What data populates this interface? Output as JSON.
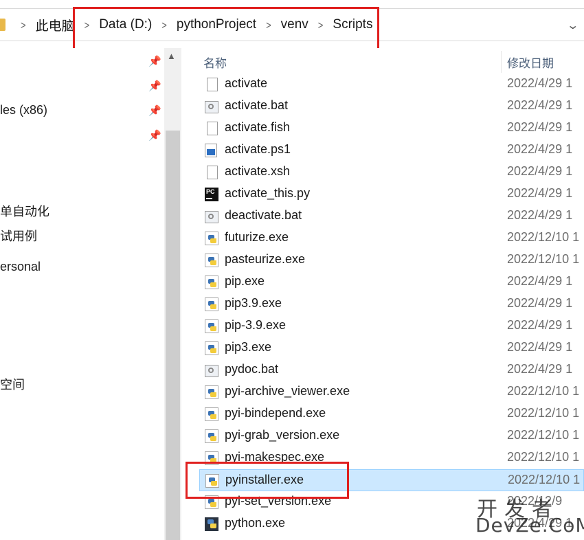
{
  "address_bar": {
    "crumbs": [
      "此电脑",
      "Data (D:)",
      "pythonProject",
      "venv",
      "Scripts"
    ],
    "separator": ">"
  },
  "nav_pane": {
    "items": [
      {
        "label": ""
      },
      {
        "label": ""
      },
      {
        "label": "les (x86)"
      },
      {
        "label": ""
      },
      {
        "label": "单自动化"
      },
      {
        "label": "试用例"
      },
      {
        "label": "ersonal"
      },
      {
        "label": "空间"
      }
    ]
  },
  "columns": {
    "name": "名称",
    "modified": "修改日期"
  },
  "files": [
    {
      "name": "activate",
      "date": "2022/4/29 1",
      "icon": "blank-file-icon"
    },
    {
      "name": "activate.bat",
      "date": "2022/4/29 1",
      "icon": "batch-file-icon"
    },
    {
      "name": "activate.fish",
      "date": "2022/4/29 1",
      "icon": "blank-file-icon"
    },
    {
      "name": "activate.ps1",
      "date": "2022/4/29 1",
      "icon": "powershell-file-icon"
    },
    {
      "name": "activate.xsh",
      "date": "2022/4/29 1",
      "icon": "blank-file-icon"
    },
    {
      "name": "activate_this.py",
      "date": "2022/4/29 1",
      "icon": "pycharm-file-icon"
    },
    {
      "name": "deactivate.bat",
      "date": "2022/4/29 1",
      "icon": "batch-file-icon"
    },
    {
      "name": "futurize.exe",
      "date": "2022/12/10 1",
      "icon": "python-exe-icon"
    },
    {
      "name": "pasteurize.exe",
      "date": "2022/12/10 1",
      "icon": "python-exe-icon"
    },
    {
      "name": "pip.exe",
      "date": "2022/4/29 1",
      "icon": "python-exe-icon"
    },
    {
      "name": "pip3.9.exe",
      "date": "2022/4/29 1",
      "icon": "python-exe-icon"
    },
    {
      "name": "pip-3.9.exe",
      "date": "2022/4/29 1",
      "icon": "python-exe-icon"
    },
    {
      "name": "pip3.exe",
      "date": "2022/4/29 1",
      "icon": "python-exe-icon"
    },
    {
      "name": "pydoc.bat",
      "date": "2022/4/29 1",
      "icon": "batch-file-icon"
    },
    {
      "name": "pyi-archive_viewer.exe",
      "date": "2022/12/10 1",
      "icon": "python-exe-icon"
    },
    {
      "name": "pyi-bindepend.exe",
      "date": "2022/12/10 1",
      "icon": "python-exe-icon"
    },
    {
      "name": "pyi-grab_version.exe",
      "date": "2022/12/10 1",
      "icon": "python-exe-icon"
    },
    {
      "name": "pyi-makespec.exe",
      "date": "2022/12/10 1",
      "icon": "python-exe-icon"
    },
    {
      "name": "pyinstaller.exe",
      "date": "2022/12/10 1",
      "icon": "python-exe-icon",
      "selected": true
    },
    {
      "name": "pyi-set_version.exe",
      "date": "2022/12/9",
      "icon": "python-exe-icon"
    },
    {
      "name": "python.exe",
      "date": "2022/4/29 1",
      "icon": "python-app-icon"
    }
  ],
  "watermark": {
    "line1": "开发者",
    "line2": "DevZe.CoM"
  },
  "colors": {
    "annotation_red": "#e0201f",
    "selection_bg": "#cce8ff",
    "selection_border": "#99d1ff"
  }
}
